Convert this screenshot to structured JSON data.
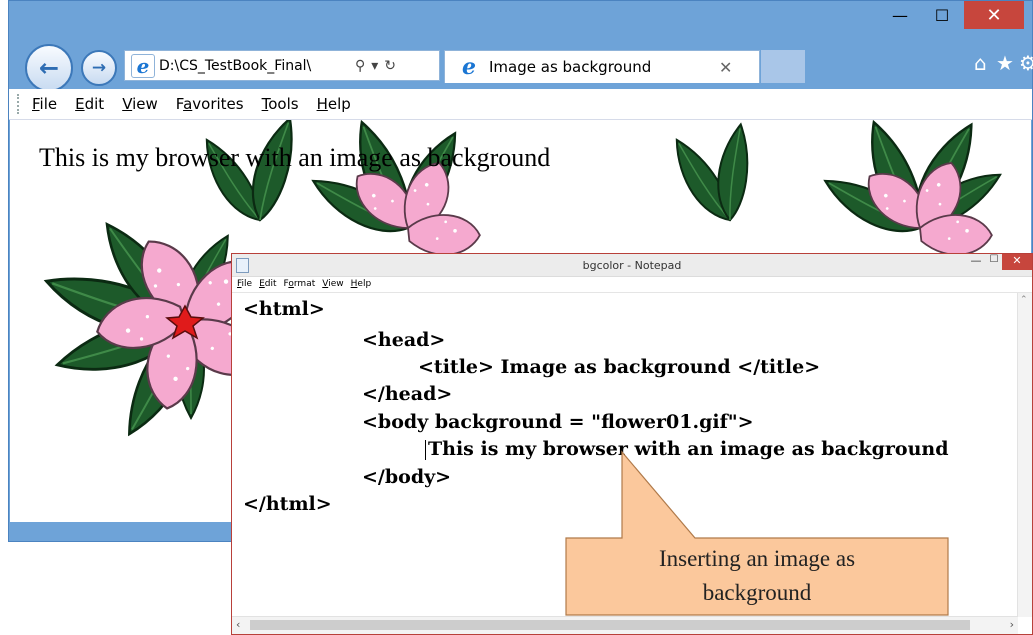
{
  "browser": {
    "address": "D:\\CS_TestBook_Final\\",
    "tab_title": "Image as background",
    "menu": [
      "File",
      "Edit",
      "View",
      "Favorites",
      "Tools",
      "Help"
    ],
    "menu_mnemonic_index": [
      0,
      0,
      0,
      1,
      0,
      0
    ],
    "page_text": "This is my browser with an image as background"
  },
  "notepad": {
    "title": "bgcolor - Notepad",
    "menu": [
      "File",
      "Edit",
      "Format",
      "View",
      "Help"
    ],
    "code_lines": [
      "<html>",
      "<head>",
      "<title> Image as background </title>",
      "</head>",
      "<body background = \"flower01.gif\">",
      "This is my browser with an image as background",
      "</body>",
      "</html>"
    ]
  },
  "callout": {
    "line1": "Inserting an image as",
    "line2": "background",
    "fill": "#fbc89c",
    "stroke": "#b07a4a"
  },
  "colors": {
    "window_frame": "#6ea3d8",
    "close_button": "#c7463d",
    "petal": "#f5a9cf",
    "leaf": "#1d5a2a",
    "flower_center": "#e01b1b"
  },
  "icons": [
    "back-arrow-icon",
    "forward-arrow-icon",
    "ie-logo-icon",
    "search-icon",
    "dropdown-icon",
    "refresh-icon",
    "close-icon",
    "home-icon",
    "star-icon",
    "gear-icon",
    "notepad-icon"
  ]
}
